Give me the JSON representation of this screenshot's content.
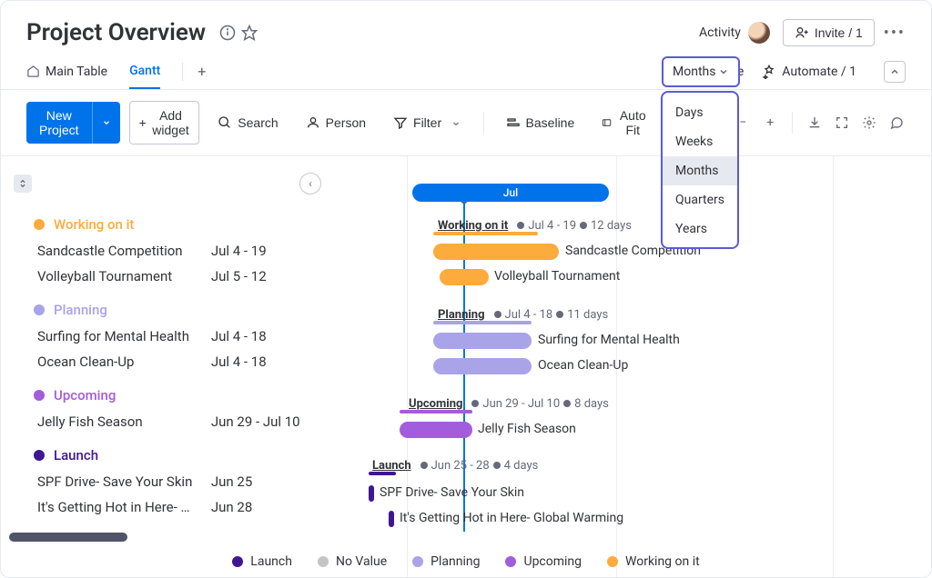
{
  "header": {
    "title": "Project Overview",
    "activity_label": "Activity",
    "invite_label": "Invite / 1"
  },
  "tabs": {
    "main_table": "Main Table",
    "gantt": "Gantt",
    "integrate": "Integrate",
    "automate": "Automate / 1"
  },
  "toolbar": {
    "new_project": "New Project",
    "add_widget": "Add widget",
    "search": "Search",
    "person": "Person",
    "filter": "Filter",
    "baseline": "Baseline",
    "auto_fit": "Auto Fit"
  },
  "timescale": {
    "selected": "Months",
    "options": [
      "Days",
      "Weeks",
      "Months",
      "Quarters",
      "Years"
    ]
  },
  "timeline": {
    "month_label": "Jul"
  },
  "groups": [
    {
      "name": "Working on it",
      "color": "#fdab3d",
      "summary_range": "Jul 4 - 19",
      "summary_duration": "12 days",
      "tasks": [
        {
          "name": "Sandcastle Competition",
          "date": "Jul 4 - 19",
          "label": "Sandcastle Competition"
        },
        {
          "name": "Volleyball Tournament",
          "date": "Jul 5 - 12",
          "label": "Volleyball Tournament"
        }
      ]
    },
    {
      "name": "Planning",
      "color": "#a9a3e8",
      "summary_range": "Jul 4 - 18",
      "summary_duration": "11 days",
      "tasks": [
        {
          "name": "Surfing for Mental Health",
          "date": "Jul 4 - 18",
          "label": "Surfing for Mental Health"
        },
        {
          "name": "Ocean Clean-Up",
          "date": "Jul 4 - 18",
          "label": "Ocean Clean-Up"
        }
      ]
    },
    {
      "name": "Upcoming",
      "color": "#a25ddc",
      "summary_range": "Jun 29 - Jul 10",
      "summary_duration": "8 days",
      "tasks": [
        {
          "name": "Jelly Fish Season",
          "date": "Jun 29 - Jul 10",
          "label": "Jelly Fish Season"
        }
      ]
    },
    {
      "name": "Launch",
      "color": "#401694",
      "summary_range": "Jun 25 - 28",
      "summary_duration": "4 days",
      "tasks": [
        {
          "name": "SPF Drive- Save Your Skin",
          "date": "Jun 25",
          "label": "SPF Drive- Save Your Skin"
        },
        {
          "name": "It's Getting Hot in Here- Glob…",
          "date": "Jun 28",
          "label": "It's Getting Hot in Here- Global Warming"
        }
      ]
    }
  ],
  "legend": [
    {
      "label": "Launch",
      "color": "#401694"
    },
    {
      "label": "No Value",
      "color": "#c4c4c4"
    },
    {
      "label": "Planning",
      "color": "#a9a3e8"
    },
    {
      "label": "Upcoming",
      "color": "#a25ddc"
    },
    {
      "label": "Working on it",
      "color": "#fdab3d"
    }
  ]
}
